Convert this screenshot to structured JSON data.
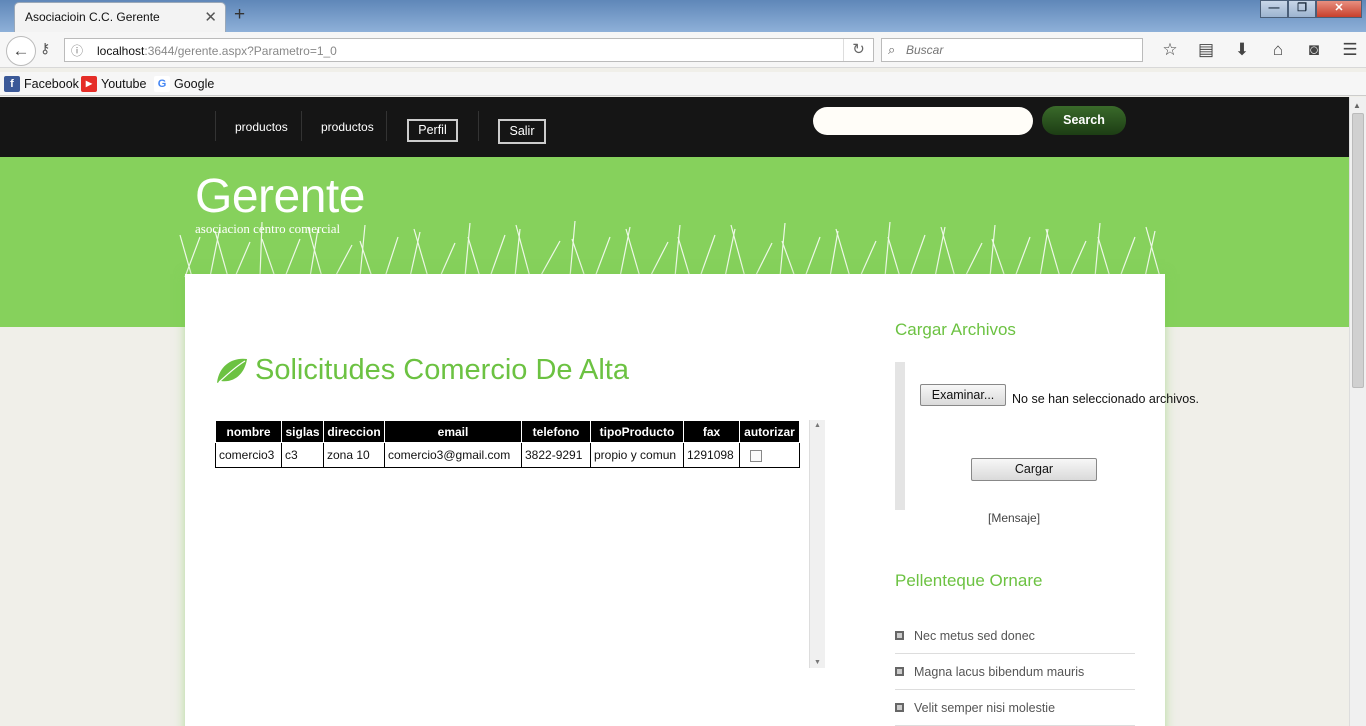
{
  "browser": {
    "tab_title": "Asociacioin C.C. Gerente",
    "url_host": "localhost",
    "url_rest": ":3644/gerente.aspx?Parametro=1_0",
    "search_placeholder": "Buscar",
    "bookmarks": [
      {
        "label": "Facebook",
        "icon": "facebook-icon",
        "color": "#3b5998"
      },
      {
        "label": "Youtube",
        "icon": "youtube-icon",
        "color": "#e52d27"
      },
      {
        "label": "Google",
        "icon": "google-icon",
        "color": "#4285f4"
      }
    ]
  },
  "site": {
    "menu": [
      "productos",
      "productos"
    ],
    "perfil_label": "Perfil",
    "salir_label": "Salir",
    "search_label": "Search",
    "title": "Gerente",
    "subtitle": "asociacion centro comercial",
    "accent": "#86d15c"
  },
  "main": {
    "heading": "Solicitudes Comercio De Alta",
    "columns": [
      "nombre",
      "siglas",
      "direccion",
      "email",
      "telefono",
      "tipoProducto",
      "fax",
      "autorizar"
    ],
    "rows": [
      [
        "comercio3",
        "c3",
        "zona 10",
        "comercio3@gmail.com",
        "3822-9291",
        "propio y comun",
        "1291098"
      ]
    ]
  },
  "sidebar": {
    "upload_heading": "Cargar Archivos",
    "browse_label": "Examinar...",
    "file_status": "No se han seleccionado archivos.",
    "upload_button": "Cargar",
    "message": "[Mensaje]",
    "list_heading": "Pellenteque Ornare",
    "list_items": [
      "Nec metus sed donec",
      "Magna lacus bibendum mauris",
      "Velit semper nisi molestie"
    ]
  }
}
